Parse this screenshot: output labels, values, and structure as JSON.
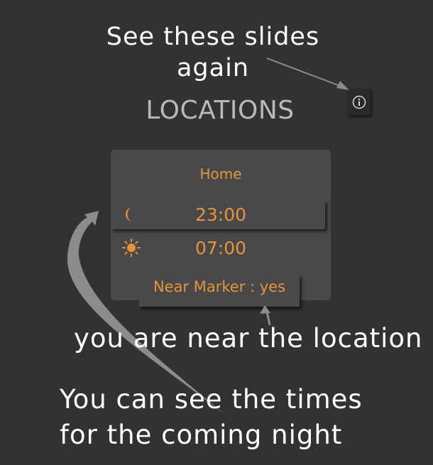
{
  "annotations": {
    "slides": [
      "See these slides",
      "again"
    ],
    "near": "you are near the location",
    "times": [
      "You can see the times",
      "for the coming night"
    ]
  },
  "header": {
    "title": "LOCATIONS",
    "info_icon": "info-icon"
  },
  "location_card": {
    "name": "Home",
    "night_time": "23:00",
    "morning_time": "07:00",
    "near_marker": "Near Marker : yes",
    "night_icon": "moon-icon",
    "morning_icon": "sun-icon"
  },
  "colors": {
    "background": "#323232",
    "card": "#4a484a",
    "accent": "#e4953a",
    "title": "#b9b9b9",
    "arrow": "#8c8c8c"
  }
}
